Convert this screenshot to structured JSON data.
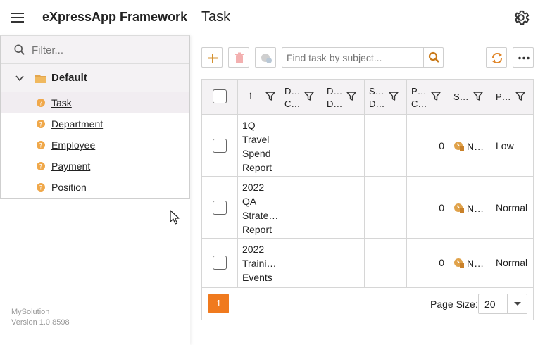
{
  "header": {
    "app_title": "eXpressApp Framework",
    "page_title": "Task"
  },
  "sidebar": {
    "filter_placeholder": "Filter...",
    "group_label": "Default",
    "items": [
      {
        "label": "Task",
        "selected": true
      },
      {
        "label": "Department",
        "selected": false
      },
      {
        "label": "Employee",
        "selected": false
      },
      {
        "label": "Payment",
        "selected": false
      },
      {
        "label": "Position",
        "selected": false
      }
    ],
    "footer": {
      "solution": "MySolution",
      "version": "Version 1.0.8598"
    }
  },
  "toolbar": {
    "search_placeholder": "Find task by subject..."
  },
  "grid": {
    "columns": [
      {
        "label": "↑"
      },
      {
        "label": "D… C…"
      },
      {
        "label": "D… D…"
      },
      {
        "label": "S… D…"
      },
      {
        "label": "P… C…"
      },
      {
        "label": "S…"
      },
      {
        "label": "P…"
      }
    ],
    "rows": [
      {
        "subject": "1Q Travel Spend Report",
        "subject_lines": [
          "1Q",
          "Travel",
          "Spend",
          "Report"
        ],
        "percent": "0",
        "status": "N…",
        "priority": "Low"
      },
      {
        "subject": "2022 QA Strate… Report",
        "subject_lines": [
          "2022",
          "QA",
          "Strate…",
          "Report"
        ],
        "percent": "0",
        "status": "N…",
        "priority": "Normal"
      },
      {
        "subject": "2022 Traini… Events",
        "subject_lines": [
          "2022",
          "Traini…",
          "Events"
        ],
        "percent": "0",
        "status": "N…",
        "priority": "Normal"
      }
    ]
  },
  "pager": {
    "current_page": "1",
    "page_size_label": "Page Size:",
    "page_size": "20"
  },
  "colors": {
    "accent": "#f07a1e",
    "new_icon": "#e0a24a",
    "refresh_icon": "#e0862a",
    "search_icon": "#c97a1a"
  }
}
